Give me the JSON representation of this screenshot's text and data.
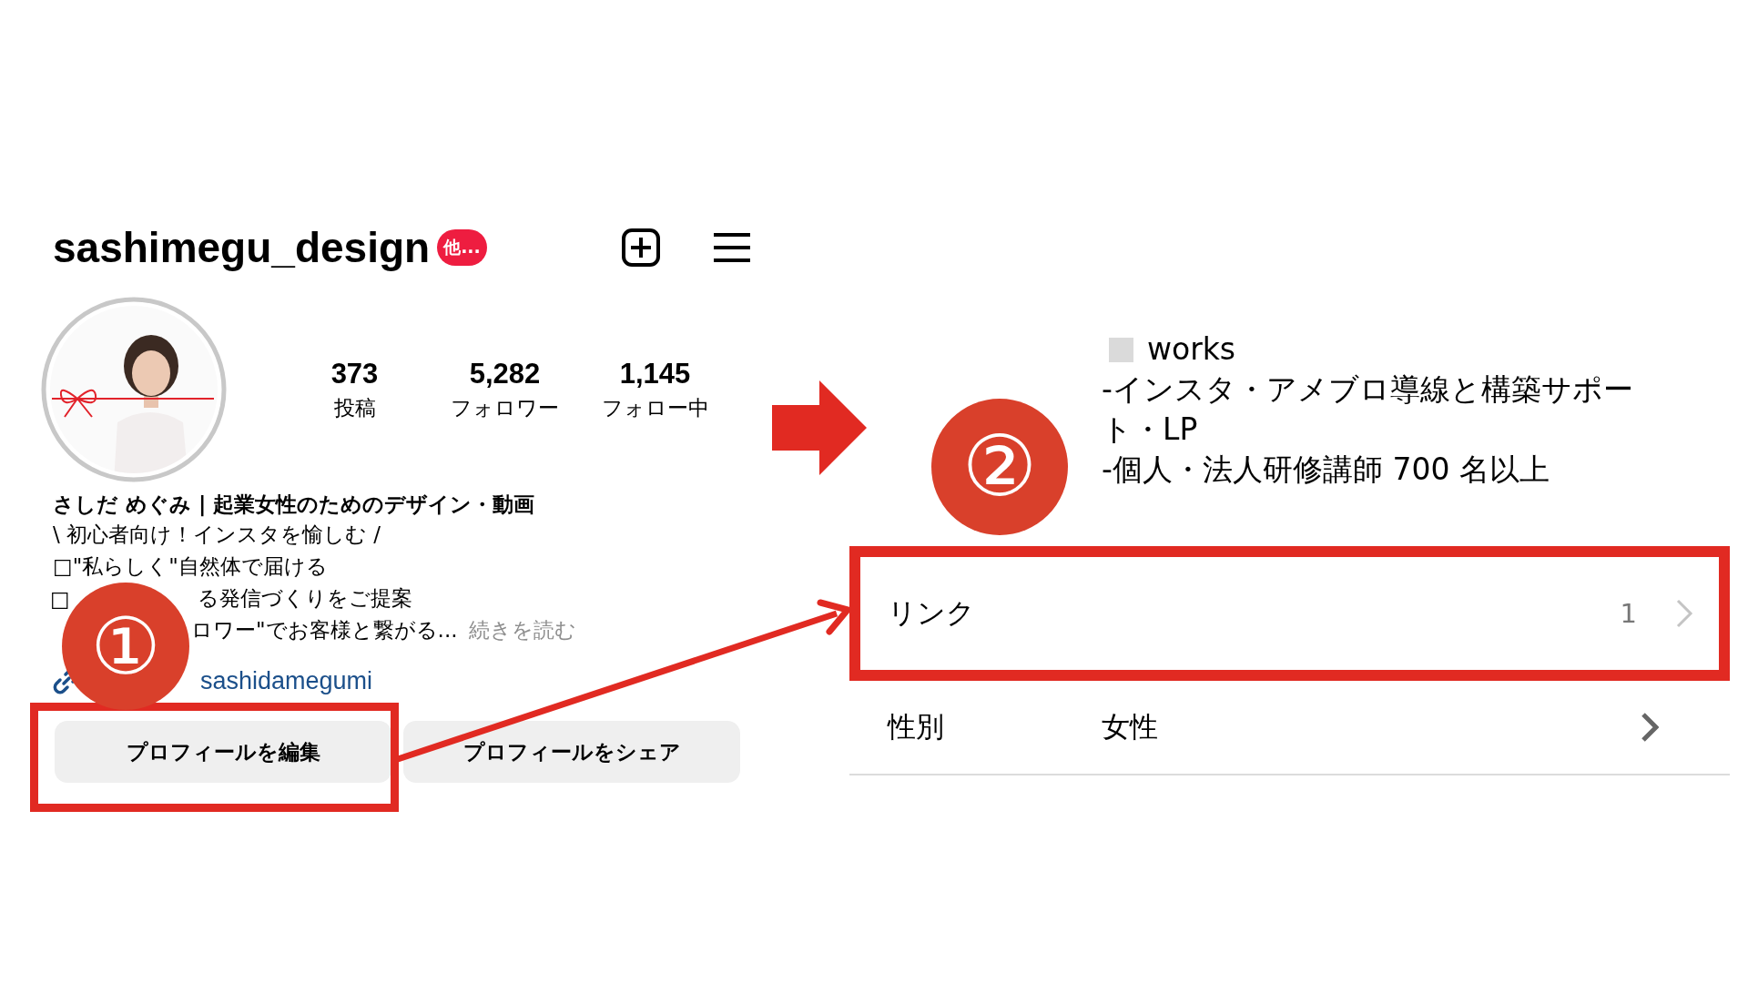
{
  "profile": {
    "username": "sashimegu_design",
    "badge": "他...",
    "stats": [
      {
        "value": "373",
        "label": "投稿"
      },
      {
        "value": "5,282",
        "label": "フォロワー"
      },
      {
        "value": "1,145",
        "label": "フォロー中"
      }
    ],
    "bio_name": "さしだ めぐみ | 起業女性のためのデザイン・動画",
    "bio_lines": [
      {
        "parts": [
          {
            "text": "\\ 初心者向け！インスタを愉しむ /",
            "muted": false
          }
        ]
      },
      {
        "parts": [
          {
            "text": "□\"私らしく\"自然体で届ける",
            "muted": false
          }
        ]
      },
      {
        "parts": [
          {
            "text": "□",
            "muted": false
          },
          {
            "text": "る発信づくりをご提案",
            "muted": false
          }
        ]
      },
      {
        "parts": [
          {
            "text": "ロワー\"でお客様と繋がる...",
            "muted": false
          },
          {
            "text": "続きを読む",
            "muted": true
          }
        ]
      }
    ],
    "link": "sashidamegumi",
    "buttons": [
      {
        "label": "プロフィールを編集",
        "highlighted": true
      },
      {
        "label": "プロフィールをシェア",
        "highlighted": false
      }
    ]
  },
  "edit_screen": {
    "bio_lines": [
      {
        "kind": "heading",
        "text": "works"
      },
      {
        "kind": "text",
        "text": "-インスタ・アメブロ導線と構築サポート・LP"
      },
      {
        "kind": "text",
        "text": "-個人・法人研修講師 700 名以上"
      }
    ],
    "rows": [
      {
        "label": "リンク",
        "value": "",
        "count": "1",
        "highlighted": true
      },
      {
        "label": "性別",
        "value": "女性",
        "count": "",
        "highlighted": false
      }
    ]
  },
  "annotations": [
    {
      "number": "①"
    },
    {
      "number": "②"
    }
  ]
}
